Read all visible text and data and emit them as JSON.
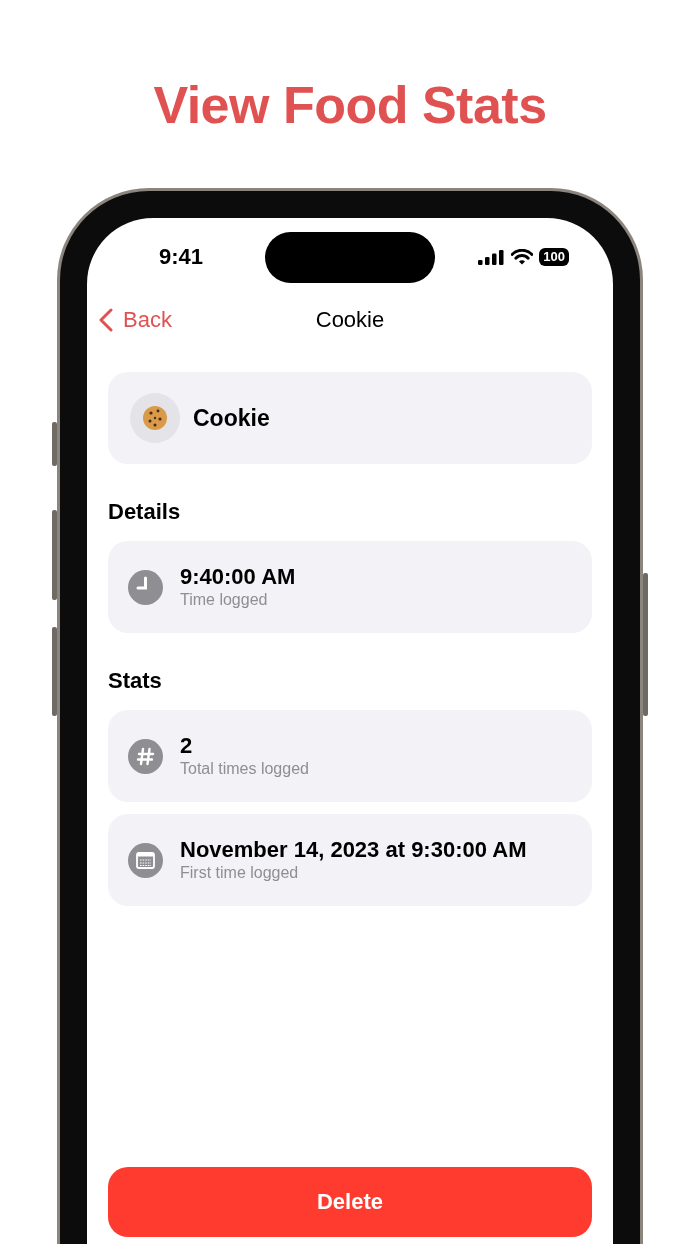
{
  "headline": "View Food Stats",
  "status_bar": {
    "time": "9:41",
    "battery": "100"
  },
  "nav": {
    "back": "Back",
    "title": "Cookie"
  },
  "food": {
    "name": "Cookie"
  },
  "sections": [
    {
      "title": "Details",
      "rows": [
        {
          "kind": "time",
          "value": "9:40:00 AM",
          "caption": "Time logged"
        }
      ]
    },
    {
      "title": "Stats",
      "rows": [
        {
          "kind": "count",
          "value": "2",
          "caption": "Total times logged"
        },
        {
          "kind": "date",
          "value": "November 14, 2023 at 9:30:00 AM",
          "caption": "First time logged"
        }
      ]
    }
  ],
  "delete_button": "Delete"
}
